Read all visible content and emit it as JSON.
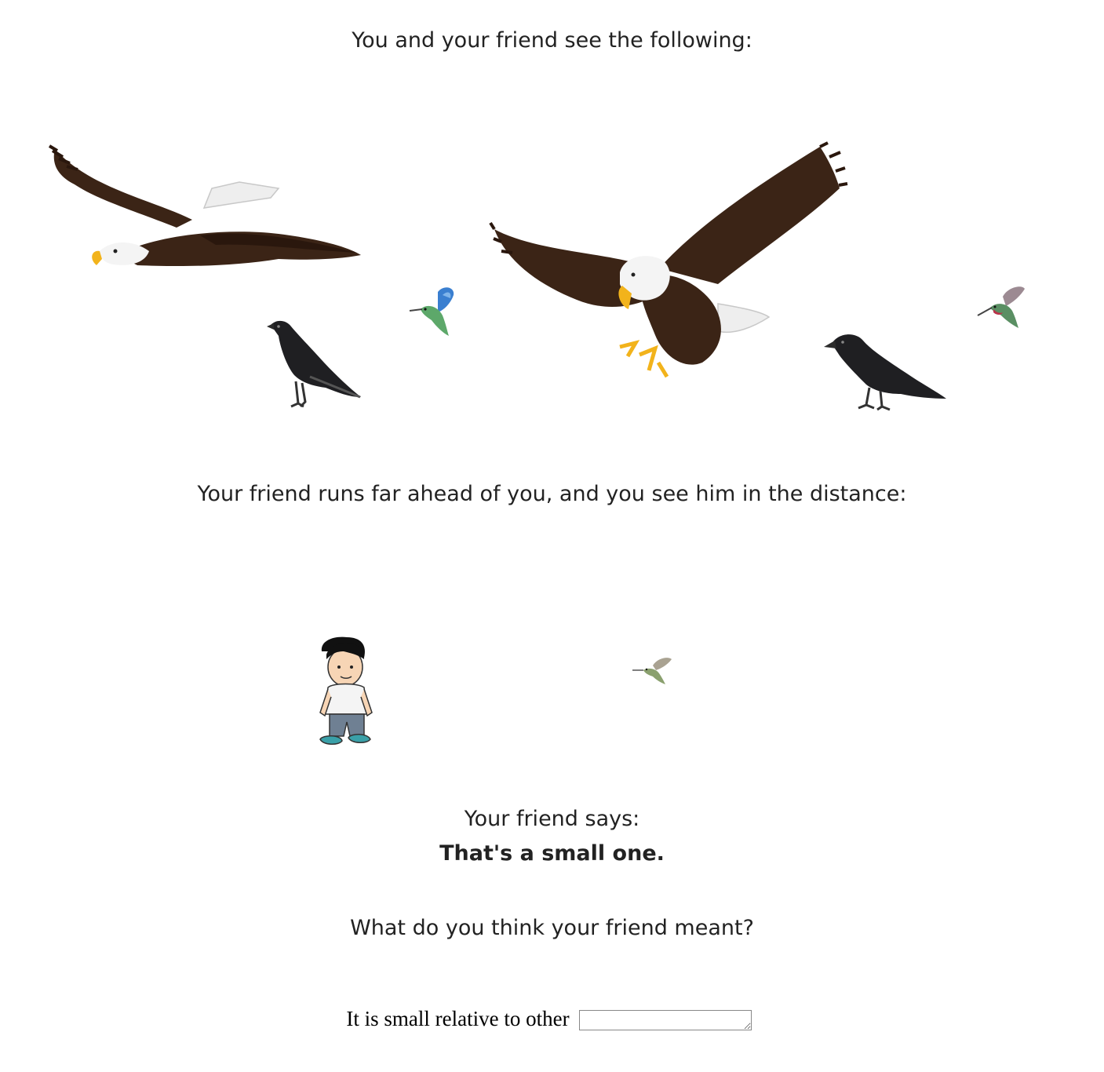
{
  "intro_text": "You and your friend see the following:",
  "ahead_text": "Your friend runs far ahead of you, and you see him in the distance:",
  "friend_says_label": "Your friend says:",
  "utterance": "That's a small one.",
  "question": "What do you think your friend meant?",
  "answer": {
    "prefix": "It is small relative to other",
    "value": ""
  },
  "scene_birds": [
    "eagle",
    "crow",
    "hummingbird",
    "eagle",
    "crow",
    "hummingbird"
  ],
  "distance_scene": [
    "friend",
    "hummingbird"
  ],
  "colors": {
    "eagle_body": "#3b2416",
    "eagle_head": "#f4f4f4",
    "beak": "#f2b31b",
    "crow": "#1f1f22",
    "hummingbird_blue": "#3a7fd0",
    "hummingbird_green": "#5da86a",
    "hummingbird_red": "#b8344a"
  }
}
